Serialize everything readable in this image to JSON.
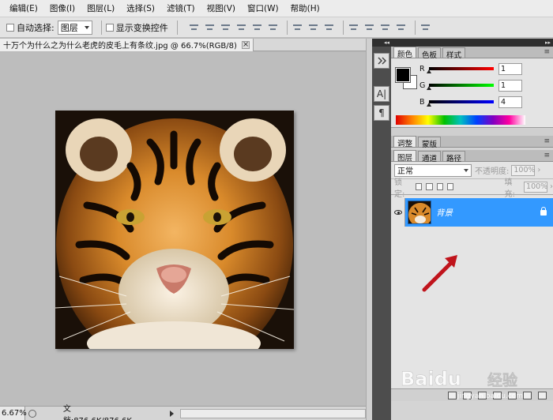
{
  "menu": {
    "items": [
      "编辑(E)",
      "图像(I)",
      "图层(L)",
      "选择(S)",
      "滤镜(T)",
      "视图(V)",
      "窗口(W)",
      "帮助(H)"
    ]
  },
  "options": {
    "auto_select_label": "自动选择:",
    "auto_select_value": "图层",
    "show_transform_label": "显示变换控件"
  },
  "document": {
    "tab_title": "十万个为什么之为什么老虎的皮毛上有条纹.jpg @ 66.7%(RGB/8)",
    "zoom": "6.67%",
    "doc_size": "文档:876.6K/876.6K"
  },
  "color_panel": {
    "tabs": [
      "颜色",
      "色板",
      "样式"
    ],
    "active_tab": "颜色",
    "r_label": "R",
    "g_label": "G",
    "b_label": "B",
    "r_value": "1",
    "g_value": "1",
    "b_value": "4",
    "foreground": "#000000",
    "background": "#ffffff"
  },
  "adjust_panel": {
    "tabs": [
      "调整",
      "蒙版"
    ]
  },
  "layers_panel": {
    "tabs": [
      "图层",
      "通道",
      "路径"
    ],
    "blend_mode": "正常",
    "opacity_label": "不透明度:",
    "opacity_value": "100%",
    "lock_label": "锁定:",
    "fill_label": "填充:",
    "fill_value": "100%",
    "layer_name": "背景",
    "selected_color": "#3399ff"
  },
  "icons": {
    "tool_1": "history-icon",
    "tool_2": "character-icon",
    "tool_3": "paragraph-icon",
    "tool_2_glyph": "A|",
    "tool_3_glyph": "¶"
  },
  "watermark": {
    "brand": "Baidu",
    "sub": "经验",
    "url": "jingyan.baidu.com"
  }
}
